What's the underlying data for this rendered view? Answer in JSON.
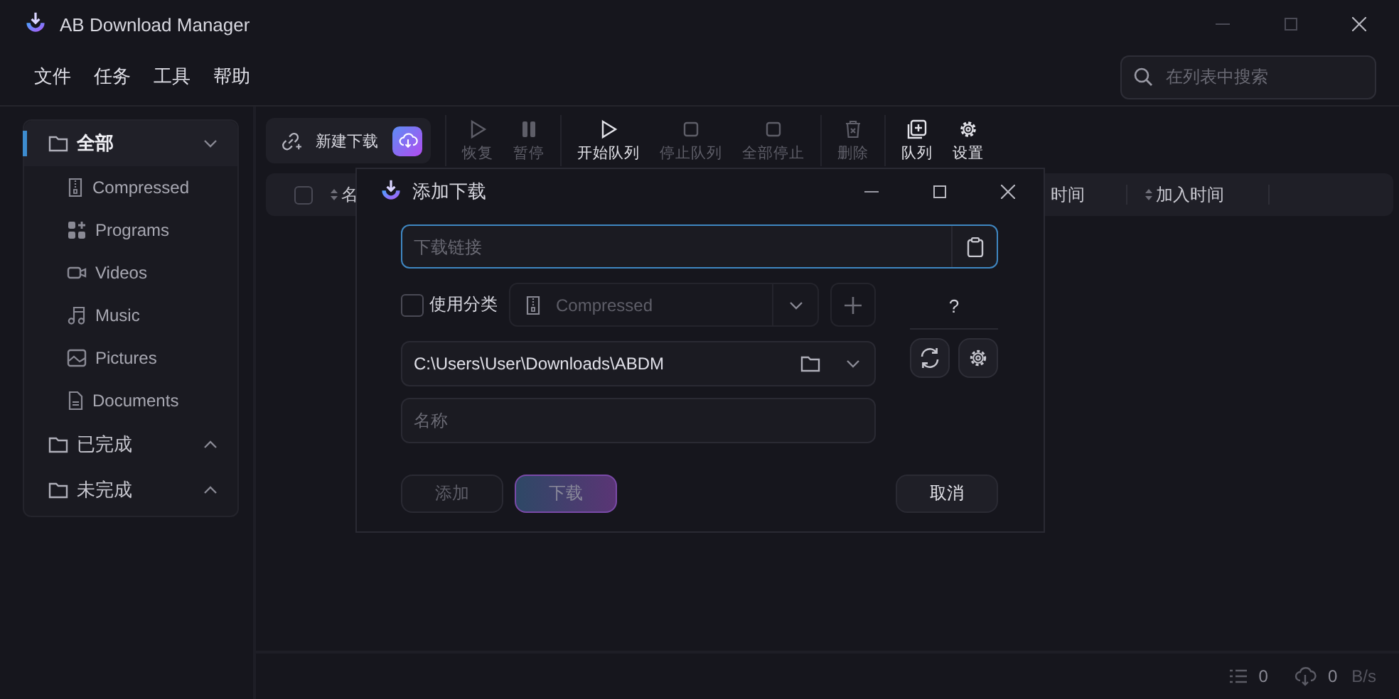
{
  "window": {
    "title": "AB Download Manager"
  },
  "menu": [
    "文件",
    "任务",
    "工具",
    "帮助"
  ],
  "search": {
    "placeholder": "在列表中搜索"
  },
  "sidebar": {
    "items": [
      {
        "label": "全部",
        "selected": true,
        "expanded": true,
        "children": [
          {
            "label": "Compressed"
          },
          {
            "label": "Programs"
          },
          {
            "label": "Videos"
          },
          {
            "label": "Music"
          },
          {
            "label": "Pictures"
          },
          {
            "label": "Documents"
          }
        ]
      },
      {
        "label": "已完成",
        "selected": false,
        "expanded": false
      },
      {
        "label": "未完成",
        "selected": false,
        "expanded": false
      }
    ]
  },
  "toolbar": {
    "new_download": "新建下载",
    "actions": [
      {
        "label": "恢复",
        "disabled": true
      },
      {
        "label": "暂停",
        "disabled": true
      },
      {
        "label": "开始队列",
        "disabled": false
      },
      {
        "label": "停止队列",
        "disabled": true
      },
      {
        "label": "全部停止",
        "disabled": true
      },
      {
        "label": "删除",
        "disabled": true
      },
      {
        "label": "队列",
        "disabled": false
      },
      {
        "label": "设置",
        "disabled": false
      }
    ]
  },
  "table": {
    "select_all": {
      "checked": false
    },
    "columns": [
      {
        "label": "名",
        "sortable": true
      },
      {
        "label": "时间",
        "sortable": false
      },
      {
        "label": "加入时间",
        "sortable": true
      }
    ]
  },
  "dialog": {
    "title": "添加下载",
    "url_field": {
      "placeholder": "下载链接",
      "focused": true
    },
    "use_category": {
      "label": "使用分类",
      "checked": false
    },
    "category": {
      "value": "Compressed",
      "disabled": true
    },
    "help": "?",
    "path_field": {
      "value": "C:\\Users\\User\\Downloads\\ABDM"
    },
    "name_field": {
      "placeholder": "名称"
    },
    "buttons": [
      {
        "label": "添加",
        "kind": "secondary",
        "disabled": true
      },
      {
        "label": "下载",
        "kind": "primary",
        "disabled": true
      },
      {
        "label": "取消",
        "kind": "secondary",
        "disabled": false
      }
    ]
  },
  "status_bar": {
    "queue_count": "0",
    "speed_value": "0",
    "speed_unit": "B/s"
  }
}
